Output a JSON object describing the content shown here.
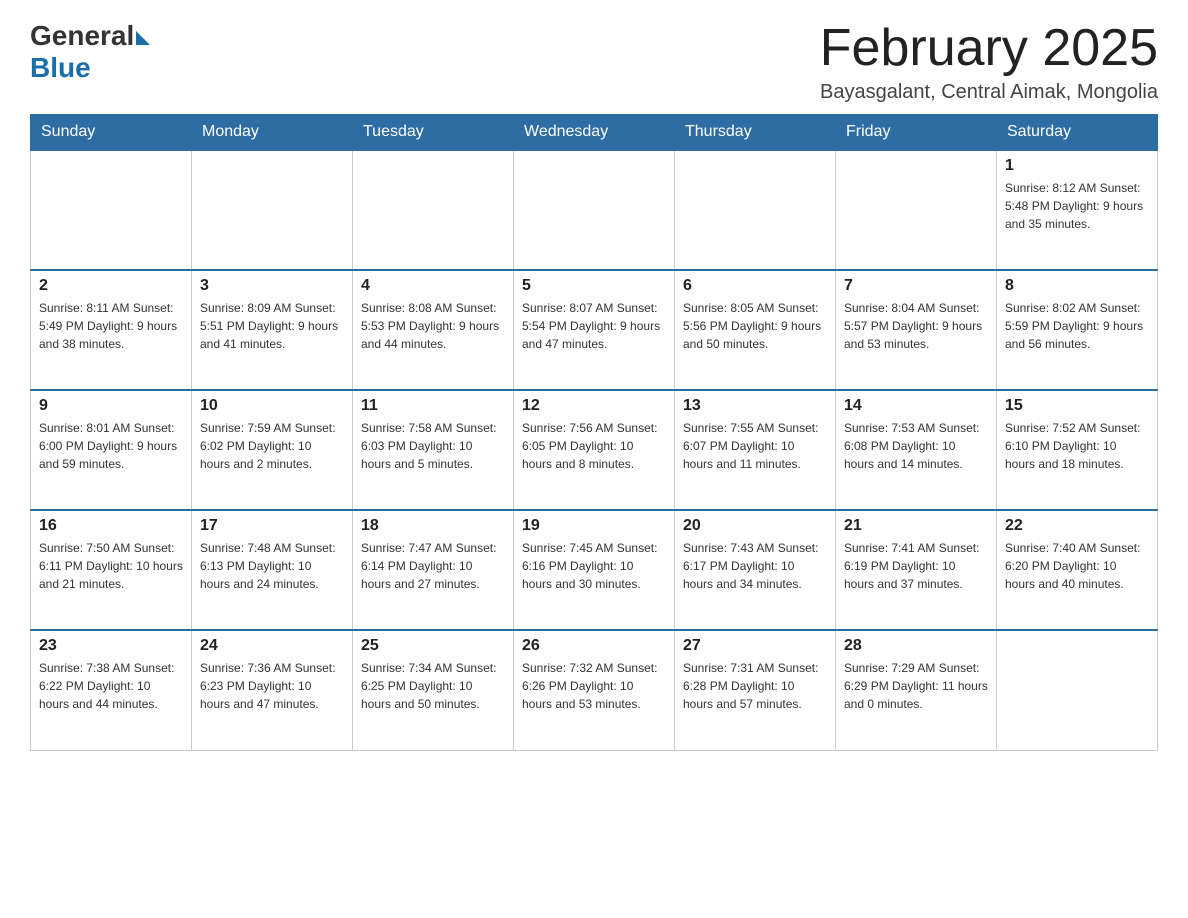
{
  "logo": {
    "general": "General",
    "blue": "Blue"
  },
  "header": {
    "title": "February 2025",
    "location": "Bayasgalant, Central Aimak, Mongolia"
  },
  "days_of_week": [
    "Sunday",
    "Monday",
    "Tuesday",
    "Wednesday",
    "Thursday",
    "Friday",
    "Saturday"
  ],
  "weeks": [
    [
      {
        "day": "",
        "info": ""
      },
      {
        "day": "",
        "info": ""
      },
      {
        "day": "",
        "info": ""
      },
      {
        "day": "",
        "info": ""
      },
      {
        "day": "",
        "info": ""
      },
      {
        "day": "",
        "info": ""
      },
      {
        "day": "1",
        "info": "Sunrise: 8:12 AM\nSunset: 5:48 PM\nDaylight: 9 hours and 35 minutes."
      }
    ],
    [
      {
        "day": "2",
        "info": "Sunrise: 8:11 AM\nSunset: 5:49 PM\nDaylight: 9 hours and 38 minutes."
      },
      {
        "day": "3",
        "info": "Sunrise: 8:09 AM\nSunset: 5:51 PM\nDaylight: 9 hours and 41 minutes."
      },
      {
        "day": "4",
        "info": "Sunrise: 8:08 AM\nSunset: 5:53 PM\nDaylight: 9 hours and 44 minutes."
      },
      {
        "day": "5",
        "info": "Sunrise: 8:07 AM\nSunset: 5:54 PM\nDaylight: 9 hours and 47 minutes."
      },
      {
        "day": "6",
        "info": "Sunrise: 8:05 AM\nSunset: 5:56 PM\nDaylight: 9 hours and 50 minutes."
      },
      {
        "day": "7",
        "info": "Sunrise: 8:04 AM\nSunset: 5:57 PM\nDaylight: 9 hours and 53 minutes."
      },
      {
        "day": "8",
        "info": "Sunrise: 8:02 AM\nSunset: 5:59 PM\nDaylight: 9 hours and 56 minutes."
      }
    ],
    [
      {
        "day": "9",
        "info": "Sunrise: 8:01 AM\nSunset: 6:00 PM\nDaylight: 9 hours and 59 minutes."
      },
      {
        "day": "10",
        "info": "Sunrise: 7:59 AM\nSunset: 6:02 PM\nDaylight: 10 hours and 2 minutes."
      },
      {
        "day": "11",
        "info": "Sunrise: 7:58 AM\nSunset: 6:03 PM\nDaylight: 10 hours and 5 minutes."
      },
      {
        "day": "12",
        "info": "Sunrise: 7:56 AM\nSunset: 6:05 PM\nDaylight: 10 hours and 8 minutes."
      },
      {
        "day": "13",
        "info": "Sunrise: 7:55 AM\nSunset: 6:07 PM\nDaylight: 10 hours and 11 minutes."
      },
      {
        "day": "14",
        "info": "Sunrise: 7:53 AM\nSunset: 6:08 PM\nDaylight: 10 hours and 14 minutes."
      },
      {
        "day": "15",
        "info": "Sunrise: 7:52 AM\nSunset: 6:10 PM\nDaylight: 10 hours and 18 minutes."
      }
    ],
    [
      {
        "day": "16",
        "info": "Sunrise: 7:50 AM\nSunset: 6:11 PM\nDaylight: 10 hours and 21 minutes."
      },
      {
        "day": "17",
        "info": "Sunrise: 7:48 AM\nSunset: 6:13 PM\nDaylight: 10 hours and 24 minutes."
      },
      {
        "day": "18",
        "info": "Sunrise: 7:47 AM\nSunset: 6:14 PM\nDaylight: 10 hours and 27 minutes."
      },
      {
        "day": "19",
        "info": "Sunrise: 7:45 AM\nSunset: 6:16 PM\nDaylight: 10 hours and 30 minutes."
      },
      {
        "day": "20",
        "info": "Sunrise: 7:43 AM\nSunset: 6:17 PM\nDaylight: 10 hours and 34 minutes."
      },
      {
        "day": "21",
        "info": "Sunrise: 7:41 AM\nSunset: 6:19 PM\nDaylight: 10 hours and 37 minutes."
      },
      {
        "day": "22",
        "info": "Sunrise: 7:40 AM\nSunset: 6:20 PM\nDaylight: 10 hours and 40 minutes."
      }
    ],
    [
      {
        "day": "23",
        "info": "Sunrise: 7:38 AM\nSunset: 6:22 PM\nDaylight: 10 hours and 44 minutes."
      },
      {
        "day": "24",
        "info": "Sunrise: 7:36 AM\nSunset: 6:23 PM\nDaylight: 10 hours and 47 minutes."
      },
      {
        "day": "25",
        "info": "Sunrise: 7:34 AM\nSunset: 6:25 PM\nDaylight: 10 hours and 50 minutes."
      },
      {
        "day": "26",
        "info": "Sunrise: 7:32 AM\nSunset: 6:26 PM\nDaylight: 10 hours and 53 minutes."
      },
      {
        "day": "27",
        "info": "Sunrise: 7:31 AM\nSunset: 6:28 PM\nDaylight: 10 hours and 57 minutes."
      },
      {
        "day": "28",
        "info": "Sunrise: 7:29 AM\nSunset: 6:29 PM\nDaylight: 11 hours and 0 minutes."
      },
      {
        "day": "",
        "info": ""
      }
    ]
  ]
}
